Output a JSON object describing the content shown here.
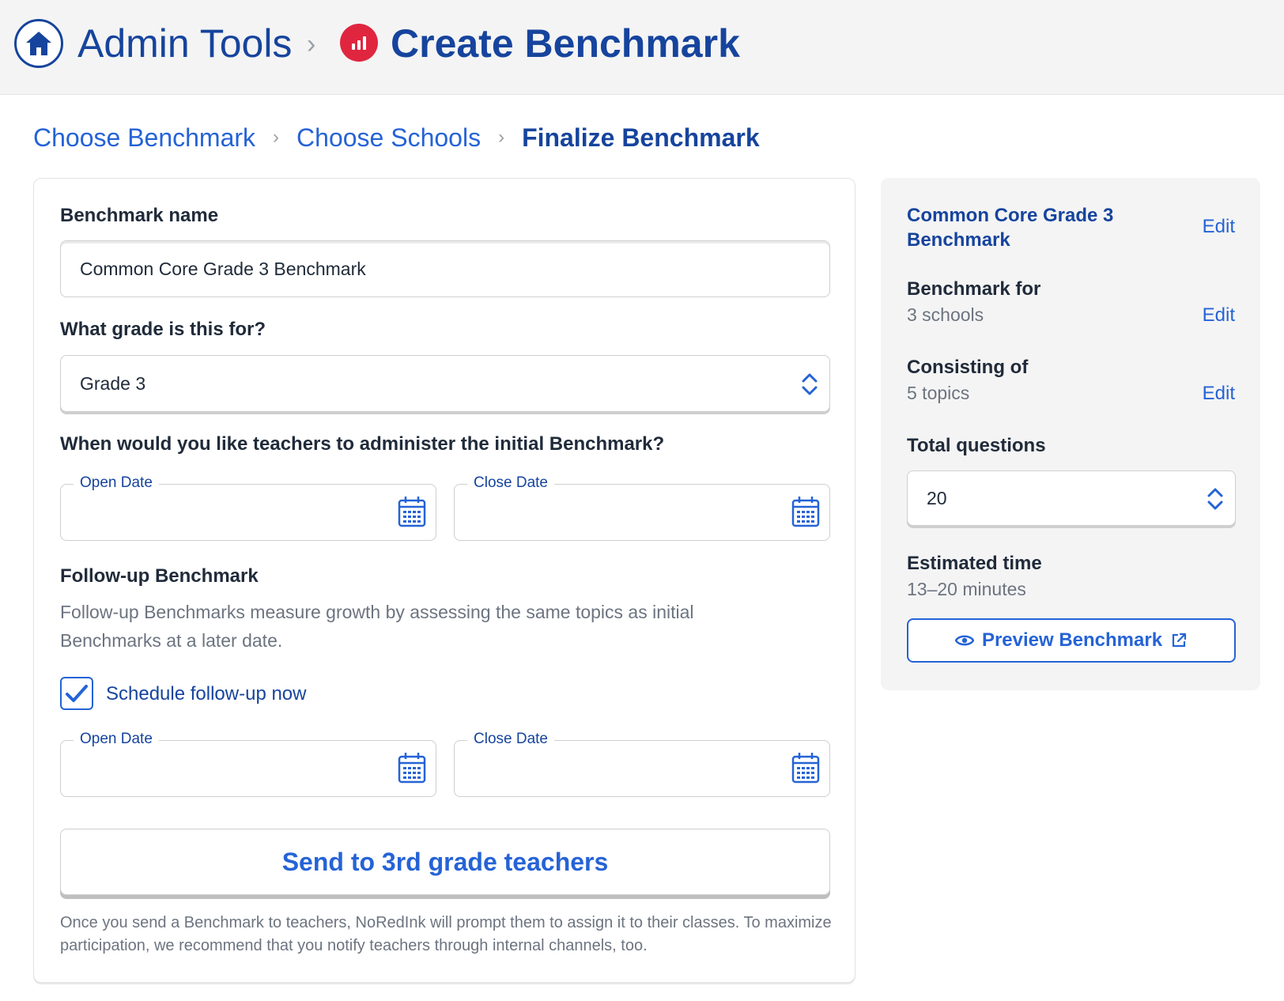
{
  "header": {
    "home_icon": "house-icon",
    "title": "Admin Tools",
    "separator": "›",
    "page_icon": "bar-chart-icon",
    "page_title": "Create Benchmark"
  },
  "steps": [
    {
      "label": "Choose Benchmark",
      "state": "link"
    },
    {
      "label": "Choose Schools",
      "state": "link"
    },
    {
      "label": "Finalize Benchmark",
      "state": "current"
    }
  ],
  "form": {
    "name_label": "Benchmark name",
    "name_value": "Common Core Grade 3 Benchmark",
    "grade_label": "What grade is this for?",
    "grade_value": "Grade 3",
    "initial_label": "When would you like teachers to administer the initial Benchmark?",
    "initial_open_label": "Open Date",
    "initial_close_label": "Close Date",
    "followup_title": "Follow-up Benchmark",
    "followup_desc": "Follow-up Benchmarks measure growth by assessing the same topics as initial Benchmarks at a later date.",
    "schedule_label": "Schedule follow-up now",
    "schedule_checked": true,
    "followup_open_label": "Open Date",
    "followup_close_label": "Close Date",
    "send_button": "Send to 3rd grade teachers",
    "note": "Once you send a Benchmark to teachers, NoRedInk will prompt them to assign it to their classes. To maximize participation, we recommend that you notify teachers through internal channels, too."
  },
  "summary": {
    "title": "Common Core Grade 3 Benchmark",
    "edit_label": "Edit",
    "for_label": "Benchmark for",
    "for_value": "3 schools",
    "consisting_label": "Consisting of",
    "consisting_value": "5 topics",
    "questions_label": "Total questions",
    "questions_value": "20",
    "time_label": "Estimated time",
    "time_value": "13–20 minutes",
    "preview_button": "Preview Benchmark"
  },
  "colors": {
    "navy": "#16449d",
    "blue": "#2563d6",
    "red": "#e0263f",
    "gray_text": "#6c7480"
  }
}
